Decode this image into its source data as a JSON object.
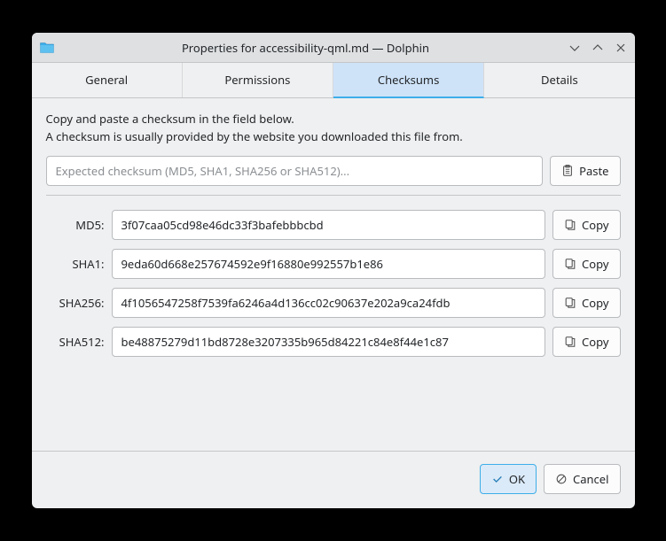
{
  "titlebar": {
    "title": "Properties for accessibility-qml.md — Dolphin"
  },
  "tabs": {
    "general": "General",
    "permissions": "Permissions",
    "checksums": "Checksums",
    "details": "Details"
  },
  "instructions": {
    "line1": "Copy and paste a checksum in the field below.",
    "line2": "A checksum is usually provided by the website you downloaded this file from."
  },
  "input": {
    "placeholder": "Expected checksum (MD5, SHA1, SHA256 or SHA512)...",
    "paste": "Paste"
  },
  "checksums": {
    "md5": {
      "label": "MD5:",
      "value": "3f07caa05cd98e46dc33f3bafebbbcbd"
    },
    "sha1": {
      "label": "SHA1:",
      "value": "9eda60d668e257674592e9f16880e992557b1e86"
    },
    "sha256": {
      "label": "SHA256:",
      "value": "4f1056547258f7539fa6246a4d136cc02c90637e202a9ca24fdb"
    },
    "sha512": {
      "label": "SHA512:",
      "value": "be48875279d11bd8728e3207335b965d84221c84e8f44e1c87"
    }
  },
  "copy_label": "Copy",
  "dialog": {
    "ok": "OK",
    "cancel": "Cancel"
  }
}
